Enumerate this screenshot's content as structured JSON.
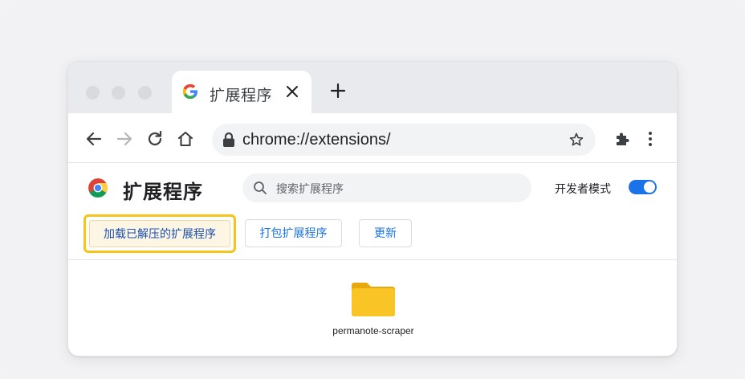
{
  "tab": {
    "title": "扩展程序"
  },
  "toolbar": {
    "url": "chrome://extensions/"
  },
  "header": {
    "title": "扩展程序",
    "search_placeholder": "搜索扩展程序",
    "dev_mode_label": "开发者模式",
    "dev_mode_enabled": true
  },
  "actions": {
    "load_unpacked": "加载已解压的扩展程序",
    "pack": "打包扩展程序",
    "update": "更新"
  },
  "folder": {
    "name": "permanote-scraper"
  },
  "colors": {
    "accent": "#1a73e8",
    "highlight": "#f5c518",
    "folder": "#f9c425"
  }
}
